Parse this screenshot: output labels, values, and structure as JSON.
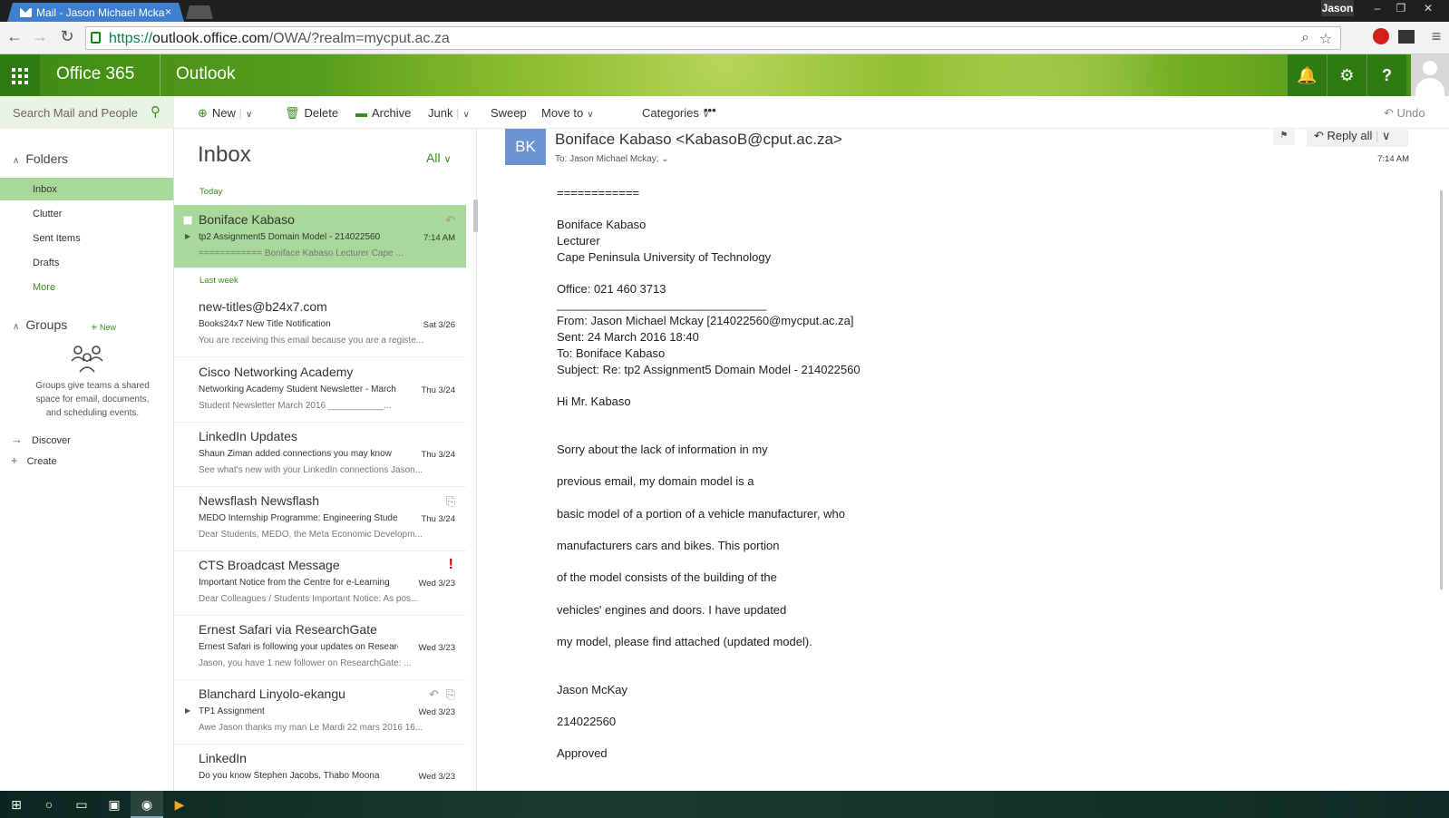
{
  "browser": {
    "tab_title": "Mail - Jason Michael Mcka",
    "tab_close": "×",
    "user": "Jason",
    "url_scheme": "https://",
    "url_host": "outlook.office.com",
    "url_path": "/OWA/?realm=mycput.ac.za"
  },
  "header": {
    "brand": "Office 365",
    "app": "Outlook"
  },
  "toolbar": {
    "search_placeholder": "Search Mail and People",
    "new": "New",
    "delete": "Delete",
    "archive": "Archive",
    "junk": "Junk",
    "sweep": "Sweep",
    "move_to": "Move to",
    "categories": "Categories",
    "more": "•••",
    "undo": "Undo"
  },
  "nav": {
    "folders_title": "Folders",
    "folders": [
      "Inbox",
      "Clutter",
      "Sent Items",
      "Drafts"
    ],
    "more": "More",
    "groups_title": "Groups",
    "groups_new": "New",
    "groups_desc": "Groups give teams a shared space for email, documents, and scheduling events.",
    "discover": "Discover",
    "create": "Create"
  },
  "list": {
    "title": "Inbox",
    "filter": "All",
    "group_today": "Today",
    "group_lastweek": "Last week",
    "items": [
      {
        "from": "Boniface Kabaso",
        "subject": "tp2 Assignment5 Domain Model - 214022560",
        "preview": "============  Boniface Kabaso Lecturer Cape ...",
        "time": "7:14 AM"
      },
      {
        "from": "new-titles@b24x7.com",
        "subject": "Books24x7 New Title Notification",
        "preview": "You are receiving this email because you are a registe...",
        "time": "Sat 3/26"
      },
      {
        "from": "Cisco Networking Academy",
        "subject": "Networking Academy Student Newsletter - March",
        "preview": "Student Newsletter          March 2016          ___________...",
        "time": "Thu 3/24"
      },
      {
        "from": "LinkedIn Updates",
        "subject": "Shaun Ziman added connections you may know",
        "preview": "See what's new with your LinkedIn connections Jason...",
        "time": "Thu 3/24"
      },
      {
        "from": "Newsflash Newsflash",
        "subject": "MEDO Internship Programme: Engineering Students",
        "preview": "Dear Students, MEDO, the Meta Economic Developm...",
        "time": "Thu 3/24"
      },
      {
        "from": "CTS Broadcast Message",
        "subject": "Important Notice from the Centre for e-Learning",
        "preview": "Dear Colleagues / Students Important Notice: As pos...",
        "time": "Wed 3/23"
      },
      {
        "from": "Ernest Safari via ResearchGate",
        "subject": "Ernest Safari is following your updates on ResearchGate",
        "preview": "Jason, you have 1 new follower on ResearchGate:          ...",
        "time": "Wed 3/23"
      },
      {
        "from": "Blanchard Linyolo-ekangu",
        "subject": "TP1 Assignment",
        "preview": "Awe Jason thanks my man    Le Mardi 22 mars 2016 16...",
        "time": "Wed 3/23"
      },
      {
        "from": "LinkedIn",
        "subject": "Do you know Stephen Jacobs, Thabo Moona",
        "preview": "",
        "time": "Wed 3/23"
      }
    ]
  },
  "message": {
    "initials": "BK",
    "sender": "Boniface Kabaso <KabasoB@cput.ac.za>",
    "to": "To:  Jason Michael Mckay;",
    "time": "7:14 AM",
    "reply_all": "Reply all",
    "body": [
      "============",
      "Boniface Kabaso",
      "Lecturer",
      "Cape Peninsula University of Technology",
      "Office: 021 460 3713",
      "________________________________",
      "From: Jason Michael Mckay [214022560@mycput.ac.za]",
      "Sent: 24 March 2016 18:40",
      "To: Boniface Kabaso",
      "Subject: Re: tp2 Assignment5 Domain Model - 214022560",
      "Hi Mr. Kabaso",
      "Sorry about the lack of information in my",
      "previous email, my domain model is a",
      "basic model of a portion of a vehicle manufacturer, who",
      "manufacturers cars and bikes. This portion",
      "of the model consists of the building of the",
      "vehicles' engines and doors. I have updated",
      "my model, please find attached (updated model).",
      "Jason McKay",
      "214022560",
      "Approved"
    ]
  },
  "colors": {
    "accent": "#3a8b1e",
    "selected": "#a9d99a",
    "header_green": "#5a9a1e",
    "avatar_blue": "#6b93cf"
  }
}
